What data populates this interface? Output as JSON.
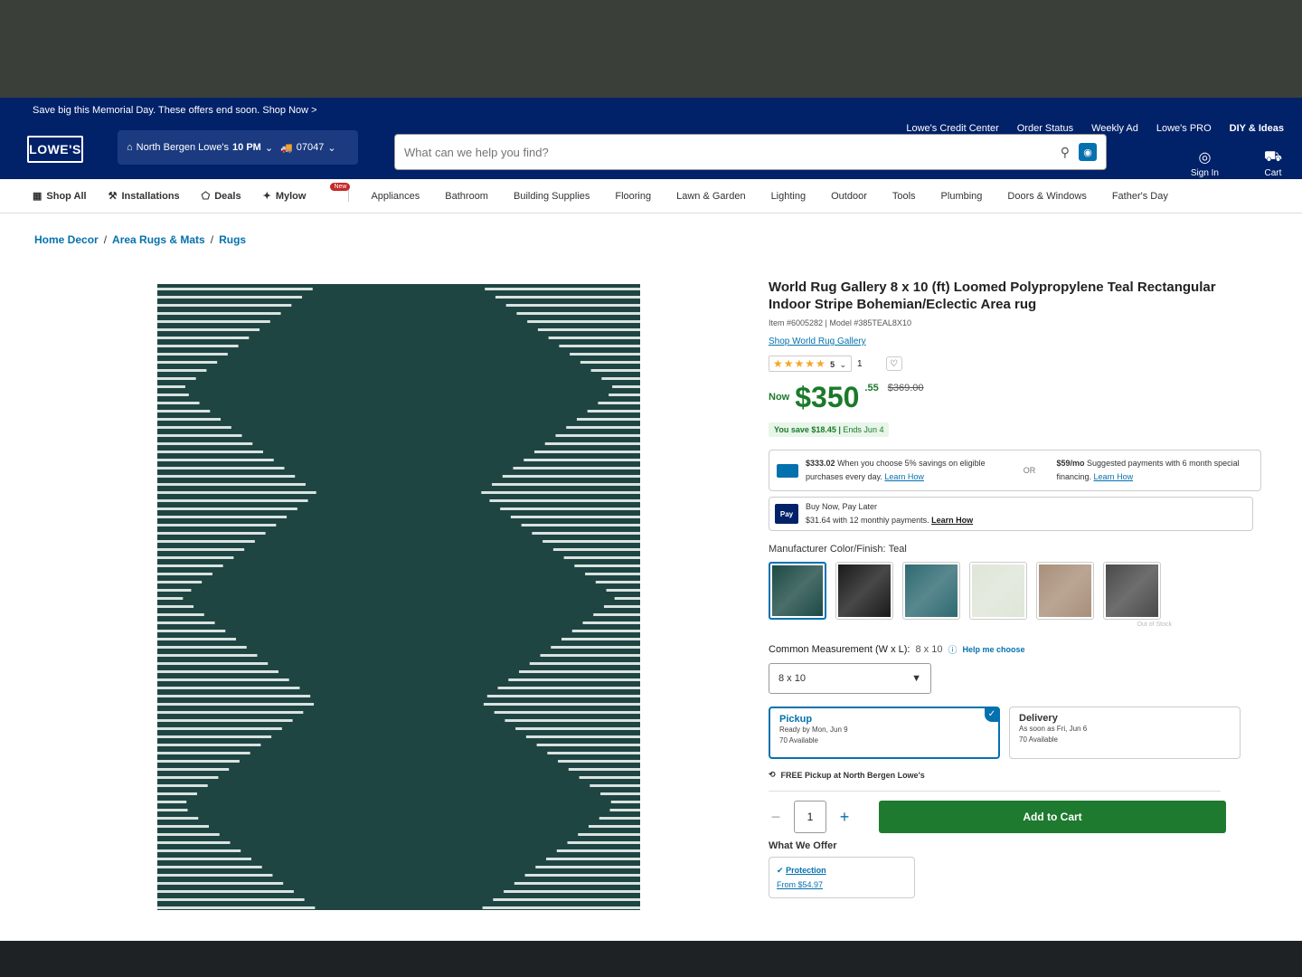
{
  "promo": {
    "text": "Save big this Memorial Day. These offers end soon. Shop Now >"
  },
  "header": {
    "top_links": [
      "Lowe's Credit Center",
      "Order Status",
      "Weekly Ad",
      "Lowe's PRO",
      "DIY & Ideas"
    ],
    "logo": "LOWE'S",
    "store": "North Bergen Lowe's",
    "store_hours": "10 PM",
    "zip": "07047",
    "search_placeholder": "What can we help you find?",
    "sign_in": "Sign In",
    "cart": "Cart"
  },
  "nav": {
    "left": [
      "Shop All",
      "Installations",
      "Deals",
      "Mylow"
    ],
    "new_badge": "New",
    "categories": [
      "Appliances",
      "Bathroom",
      "Building Supplies",
      "Flooring",
      "Lawn & Garden",
      "Lighting",
      "Outdoor",
      "Tools",
      "Plumbing",
      "Doors & Windows",
      "Father's Day"
    ]
  },
  "breadcrumb": [
    "Home Decor",
    "Area Rugs & Mats",
    "Rugs"
  ],
  "product": {
    "title": "World Rug Gallery 8 x 10 (ft) Loomed Polypropylene Teal Rectangular Indoor Stripe Bohemian/Eclectic Area rug",
    "meta": "Item #6005282 | Model #385TEAL8X10",
    "brand_link": "Shop World Rug Gallery",
    "rating_stars": "★★★★★",
    "rating": "5",
    "review_count": "1",
    "now_label": "Now",
    "price": "$350",
    "cents": ".55",
    "was_price": "$369.00",
    "save_text": "You save $18.45",
    "ends_text": "Ends Jun 4",
    "credit_offer_amount": "$333.02",
    "credit_offer_text": "When you choose 5% savings on eligible purchases every day.",
    "learn_how": "Learn How",
    "or": "OR",
    "financing_amount": "$59/mo",
    "financing_text": "Suggested payments with 6 month special financing.",
    "bnpl_title": "Buy Now, Pay Later",
    "bnpl_text": "$31.64 with 12 monthly payments.",
    "pay_logo": "Pay",
    "color_label": "Manufacturer Color/Finish:",
    "color_value": "Teal",
    "out_of_stock": "Out of Stock",
    "measure_label": "Common Measurement (W x L):",
    "measure_value": "8 x 10",
    "help_choose": "Help me choose",
    "size_selected": "8 x 10",
    "pickup_title": "Pickup",
    "pickup_ready": "Ready by Mon, Jun 9",
    "pickup_avail": "70 Available",
    "delivery_title": "Delivery",
    "delivery_when": "As soon as Fri, Jun 6",
    "delivery_avail": "70 Available",
    "free_pickup": "FREE Pickup at North Bergen Lowe's",
    "qty": "1",
    "add_to_cart": "Add to Cart",
    "offer_label": "What We Offer",
    "protection": "Protection",
    "protection_from": "From $54.97"
  },
  "swatch_colors": [
    "#1d4a45",
    "#1a1a1a",
    "#2f6a72",
    "#dfe5d8",
    "#a98f7a",
    "#4a4a4a"
  ],
  "colors": {
    "lowes_blue": "#012169",
    "link_blue": "#0471af",
    "price_green": "#1b7a2a",
    "cart_green": "#1e7a2e"
  }
}
